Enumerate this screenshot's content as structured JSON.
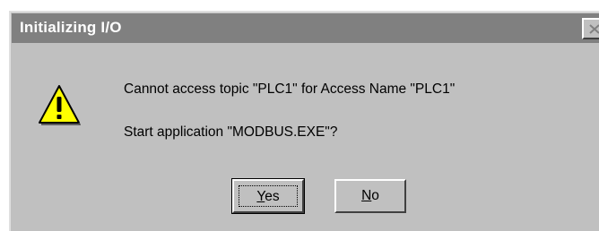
{
  "window": {
    "title": "Initializing I/O",
    "close_icon": "close-icon"
  },
  "message": {
    "icon": "warning-icon",
    "line1": "Cannot access topic \"PLC1\" for Access Name \"PLC1\"",
    "line2": "Start application \"MODBUS.EXE\"?"
  },
  "buttons": {
    "yes_label": "Yes",
    "yes_mnemonic": "Y",
    "yes_rest": "es",
    "no_label": "No",
    "no_mnemonic": "N",
    "no_rest": "o"
  },
  "colors": {
    "dialog_bg": "#c0c0c0",
    "titlebar_bg": "#808080",
    "warning_fill": "#ffff00"
  }
}
